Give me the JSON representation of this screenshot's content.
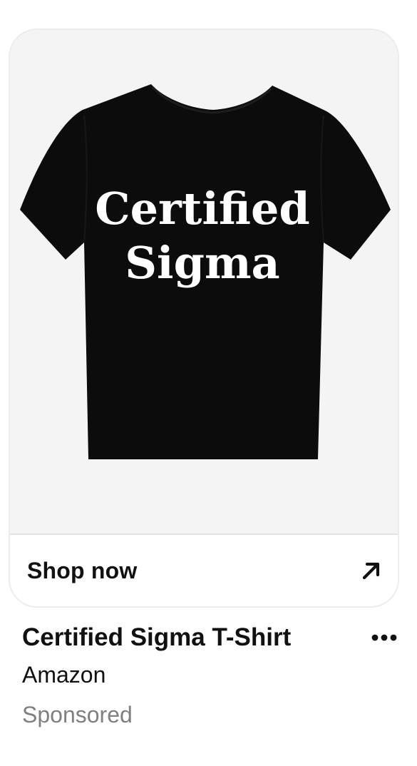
{
  "ad_card": {
    "image": {
      "alt": "black t-shirt",
      "print_text_line1": "Certified",
      "print_text_line2": "Sigma",
      "shirt_color": "#0c0c0c",
      "print_color": "#ffffff",
      "background_color": "#f4f4f4"
    },
    "cta": {
      "label": "Shop now",
      "icon": "arrow-up-right-icon"
    }
  },
  "meta": {
    "title": "Certified Sigma T-Shirt",
    "more_icon": "more-horizontal-icon",
    "merchant": "Amazon",
    "sponsored": "Sponsored"
  }
}
